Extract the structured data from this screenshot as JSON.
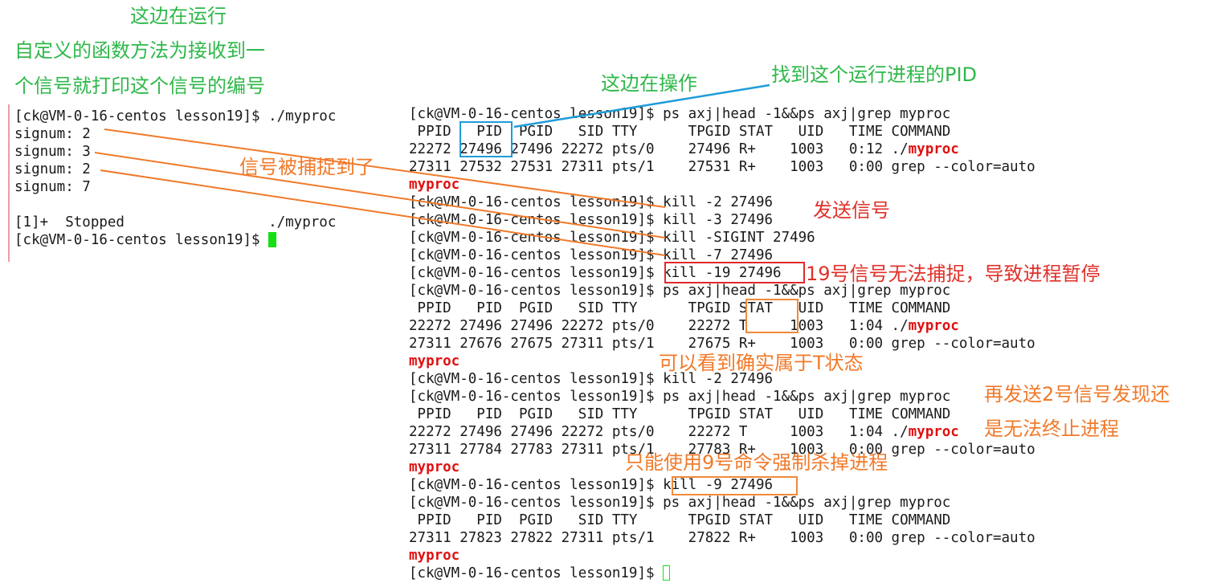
{
  "left_terminal": {
    "lines": [
      "[ck@VM-0-16-centos lesson19]$ ./myproc",
      "signum: 2",
      "signum: 3",
      "signum: 2",
      "signum: 7",
      "",
      "[1]+  Stopped                 ./myproc",
      "[ck@VM-0-16-centos lesson19]$ "
    ]
  },
  "right_terminal": {
    "lines": [
      {
        "text": "[ck@VM-0-16-centos lesson19]$ ps axj|head -1&&ps axj|grep myproc"
      },
      {
        "text": " PPID   PID  PGID   SID TTY      TPGID STAT   UID   TIME COMMAND"
      },
      {
        "text": "22272 27496 27496 22272 pts/0    27496 R+    1003   0:12 ./",
        "hl": "myproc"
      },
      {
        "text": "27311 27532 27531 27311 pts/1    27531 R+    1003   0:00 grep --color=auto"
      },
      {
        "text": "",
        "hl": "myproc"
      },
      {
        "text": "[ck@VM-0-16-centos lesson19]$ kill -2 27496"
      },
      {
        "text": "[ck@VM-0-16-centos lesson19]$ kill -3 27496"
      },
      {
        "text": "[ck@VM-0-16-centos lesson19]$ kill -SIGINT 27496"
      },
      {
        "text": "[ck@VM-0-16-centos lesson19]$ kill -7 27496"
      },
      {
        "text": "[ck@VM-0-16-centos lesson19]$ kill -19 27496"
      },
      {
        "text": "[ck@VM-0-16-centos lesson19]$ ps axj|head -1&&ps axj|grep myproc"
      },
      {
        "text": " PPID   PID  PGID   SID TTY      TPGID STAT   UID   TIME COMMAND"
      },
      {
        "text": "22272 27496 27496 22272 pts/0    22272 T     1003   1:04 ./",
        "hl": "myproc"
      },
      {
        "text": "27311 27676 27675 27311 pts/1    27675 R+    1003   0:00 grep --color=auto"
      },
      {
        "text": "",
        "hl": "myproc"
      },
      {
        "text": "[ck@VM-0-16-centos lesson19]$ kill -2 27496"
      },
      {
        "text": "[ck@VM-0-16-centos lesson19]$ ps axj|head -1&&ps axj|grep myproc"
      },
      {
        "text": " PPID   PID  PGID   SID TTY      TPGID STAT   UID   TIME COMMAND"
      },
      {
        "text": "22272 27496 27496 22272 pts/0    22272 T     1003   1:04 ./",
        "hl": "myproc"
      },
      {
        "text": "27311 27784 27783 27311 pts/1    27783 R+    1003   0:00 grep --color=auto"
      },
      {
        "text": "",
        "hl": "myproc"
      },
      {
        "text": "[ck@VM-0-16-centos lesson19]$ kill -9 27496"
      },
      {
        "text": "[ck@VM-0-16-centos lesson19]$ ps axj|head -1&&ps axj|grep myproc"
      },
      {
        "text": " PPID   PID  PGID   SID TTY      TPGID STAT   UID   TIME COMMAND"
      },
      {
        "text": "27311 27823 27822 27311 pts/1    27822 R+    1003   0:00 grep --color=auto"
      },
      {
        "text": "",
        "hl": "myproc"
      },
      {
        "text": "[ck@VM-0-16-centos lesson19]$ "
      }
    ]
  },
  "annotations": {
    "left_running": "这边在运行",
    "handler_line1": "自定义的函数方法为接收到一",
    "handler_line2": "个信号就打印这个信号的编号",
    "right_operating": "这边在操作",
    "find_pid": "找到这个运行进程的PID",
    "caught": "信号被捕捉到了",
    "send_signal": "发送信号",
    "sig19": "19号信号无法捕捉，导致进程暂停",
    "t_state": "可以看到确实属于T状态",
    "resend_line1": "再发送2号信号发现还",
    "resend_line2": "是无法终止进程",
    "kill9": "只能使用9号命令强制杀掉进程"
  },
  "colors": {
    "green": "#2fb84a",
    "orange": "#f07a2a",
    "red": "#e0312a",
    "blue": "#1e9cd8",
    "cursor": "#14e014",
    "highlight": "#e01010"
  }
}
